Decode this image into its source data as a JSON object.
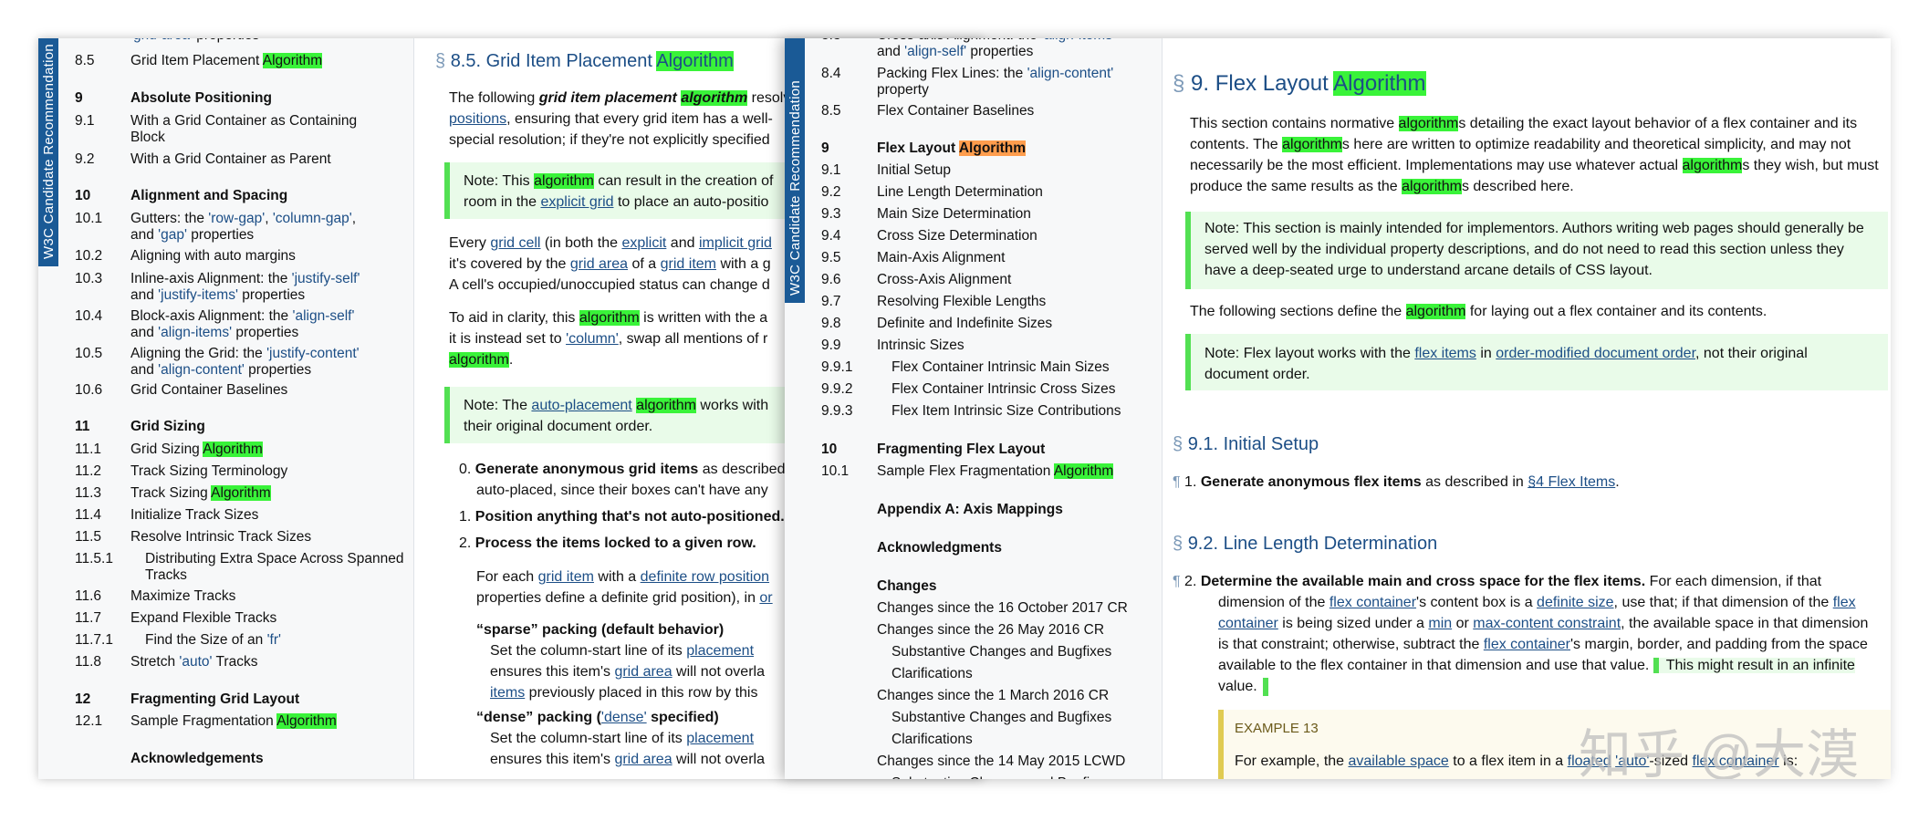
{
  "banner_text": "W3C Candidate Recommendation",
  "grid_toc": [
    {
      "num": "",
      "title": "'grid-area' properties",
      "clip": true
    },
    {
      "num": "8.5",
      "title": "Grid Item Placement ",
      "hl": "Algorithm"
    },
    {
      "num": "9",
      "title": "Absolute Positioning",
      "bold": true
    },
    {
      "num": "9.1",
      "title": "With a Grid Container as Containing",
      "title2": "Block"
    },
    {
      "num": "9.2",
      "title": "With a Grid Container as Parent"
    },
    {
      "num": "10",
      "title": "Alignment and Spacing",
      "bold": true
    },
    {
      "num": "10.1",
      "title": "Gutters: the 'row-gap', 'column-gap',",
      "title2": "and 'gap' properties"
    },
    {
      "num": "10.2",
      "title": "Aligning with auto margins"
    },
    {
      "num": "10.3",
      "title": "Inline-axis Alignment: the 'justify-self'",
      "title2": "and 'justify-items' properties"
    },
    {
      "num": "10.4",
      "title": "Block-axis Alignment: the 'align-self'",
      "title2": "and 'align-items' properties"
    },
    {
      "num": "10.5",
      "title": "Aligning the Grid: the 'justify-content'",
      "title2": "and 'align-content' properties"
    },
    {
      "num": "10.6",
      "title": "Grid Container Baselines"
    },
    {
      "num": "11",
      "title": "Grid Sizing",
      "bold": true
    },
    {
      "num": "11.1",
      "title": "Grid Sizing ",
      "hl": "Algorithm"
    },
    {
      "num": "11.2",
      "title": "Track Sizing Terminology"
    },
    {
      "num": "11.3",
      "title": "Track Sizing ",
      "hl": "Algorithm"
    },
    {
      "num": "11.4",
      "title": "Initialize Track Sizes"
    },
    {
      "num": "11.5",
      "title": "Resolve Intrinsic Track Sizes"
    },
    {
      "num": "11.5.1",
      "title": "Distributing Extra Space Across Spanned",
      "title2": "Tracks",
      "indent": true
    },
    {
      "num": "11.6",
      "title": "Maximize Tracks"
    },
    {
      "num": "11.7",
      "title": "Expand Flexible Tracks"
    },
    {
      "num": "11.7.1",
      "title": "Find the Size of an 'fr'",
      "indent": true
    },
    {
      "num": "11.8",
      "title": "Stretch 'auto' Tracks"
    },
    {
      "num": "12",
      "title": "Fragmenting Grid Layout",
      "bold": true
    },
    {
      "num": "12.1",
      "title": "Sample Fragmentation ",
      "hl": "Algorithm"
    },
    {
      "num": "",
      "title": "Acknowledgements",
      "bold": true
    }
  ],
  "grid_doc": {
    "heading_sign": "§",
    "heading": "8.5. Grid Item Placement ",
    "heading_hl": "Algorithm",
    "p1": [
      "The following ",
      "grid item placement ",
      "algorithm",
      " resolv"
    ],
    "p1b": [
      "positions",
      ", ensuring that every grid item has a well-"
    ],
    "p1c": "special resolution; if they're not explicitly specified",
    "note1a": [
      "Note: This ",
      "algorithm",
      " can result in the creation of"
    ],
    "note1b": [
      "room in the ",
      "explicit grid",
      " to place an auto-positio"
    ],
    "p2a": [
      "Every ",
      "grid cell",
      " (in both the ",
      "explicit",
      " and ",
      "implicit grid"
    ],
    "p2b": [
      "it's covered by the ",
      "grid area",
      " of a ",
      "grid item",
      " with a g"
    ],
    "p2c": "A cell's occupied/unoccupied status can change d",
    "p3a": [
      "To aid in clarity, this ",
      "algorithm",
      " is written with the a"
    ],
    "p3b": [
      "it is instead set to ",
      "'column'",
      ", swap all mentions of r"
    ],
    "p3c": [
      "algorithm",
      "."
    ],
    "note2a": [
      "Note: The ",
      "auto-placement",
      " ",
      "algorithm",
      " works with"
    ],
    "note2b": "their original document order.",
    "li0a": [
      "0. ",
      "Generate anonymous grid items",
      " as described"
    ],
    "li0b": "auto-placed, since their boxes can't have any",
    "li1": [
      "1. ",
      "Position anything that's not auto-positioned."
    ],
    "li2": [
      "2. ",
      "Process the items locked to a given row."
    ],
    "li2a": [
      "For each ",
      "grid item",
      " with a ",
      "definite row position"
    ],
    "li2b": [
      "properties define a definite grid position), in ",
      "or"
    ],
    "sparse": "“sparse” packing (default behavior)",
    "sparse_a": [
      "Set the column-start line of its ",
      "placement"
    ],
    "sparse_b": [
      "ensures this item's ",
      "grid area",
      " will not overla"
    ],
    "sparse_c": [
      "items",
      " previously placed in this row by this"
    ],
    "dense": [
      "“dense” packing (",
      "'dense'",
      " specified)"
    ],
    "dense_a": [
      "Set the column-start line of its ",
      "placement"
    ],
    "dense_b": [
      "ensures this item's ",
      "grid area",
      " will not overla"
    ]
  },
  "flex_toc": [
    {
      "num": "8.3",
      "title": "Cross-axis Alignment: the 'align-items'",
      "clip": true
    },
    {
      "num": "",
      "title": "and 'align-self' properties"
    },
    {
      "num": "8.4",
      "title": "Packing Flex Lines: the 'align-content'",
      "title2": "property"
    },
    {
      "num": "8.5",
      "title": "Flex Container Baselines"
    },
    {
      "num": "9",
      "title": "Flex Layout ",
      "hl_orange": "Algorithm",
      "bold": true
    },
    {
      "num": "9.1",
      "title": "Initial Setup"
    },
    {
      "num": "9.2",
      "title": "Line Length Determination"
    },
    {
      "num": "9.3",
      "title": "Main Size Determination"
    },
    {
      "num": "9.4",
      "title": "Cross Size Determination"
    },
    {
      "num": "9.5",
      "title": "Main-Axis Alignment"
    },
    {
      "num": "9.6",
      "title": "Cross-Axis Alignment"
    },
    {
      "num": "9.7",
      "title": "Resolving Flexible Lengths"
    },
    {
      "num": "9.8",
      "title": "Definite and Indefinite Sizes"
    },
    {
      "num": "9.9",
      "title": "Intrinsic Sizes"
    },
    {
      "num": "9.9.1",
      "title": "Flex Container Intrinsic Main Sizes",
      "indent": true
    },
    {
      "num": "9.9.2",
      "title": "Flex Container Intrinsic Cross Sizes",
      "indent": true
    },
    {
      "num": "9.9.3",
      "title": "Flex Item Intrinsic Size Contributions",
      "indent": true
    },
    {
      "num": "10",
      "title": "Fragmenting Flex Layout",
      "bold": true
    },
    {
      "num": "10.1",
      "title": "Sample Flex Fragmentation ",
      "hl": "Algorithm"
    },
    {
      "num": "",
      "title": "Appendix A: Axis Mappings",
      "bold": true
    },
    {
      "num": "",
      "title": "Acknowledgments",
      "bold": true
    },
    {
      "num": "",
      "title": "Changes",
      "bold": true
    },
    {
      "num": "",
      "title": "Changes since the 16 October 2017 CR"
    },
    {
      "num": "",
      "title": "Changes since the 26 May 2016 CR"
    },
    {
      "num": "",
      "title": "Substantive Changes and Bugfixes",
      "indent": true
    },
    {
      "num": "",
      "title": "Clarifications",
      "indent": true
    },
    {
      "num": "",
      "title": "Changes since the 1 March 2016 CR"
    },
    {
      "num": "",
      "title": "Substantive Changes and Bugfixes",
      "indent": true
    },
    {
      "num": "",
      "title": "Clarifications",
      "indent": true
    },
    {
      "num": "",
      "title": "Changes since the 14 May 2015 LCWD"
    },
    {
      "num": "",
      "title": "Substantive Changes and Bugfixes",
      "indent": true,
      "clip": true
    }
  ],
  "flex_doc": {
    "heading_sign": "§",
    "heading": "9. Flex Layout ",
    "heading_hl": "Algorithm",
    "p1a": [
      "This section contains normative ",
      "algorithm",
      "s detailing the exact layout behavior of a flex container and its"
    ],
    "p1b": [
      "contents. The ",
      "algorithm",
      "s here are written to optimize readability and theoretical simplicity, and may not"
    ],
    "p1c": [
      "necessarily be the most efficient. Implementations may use whatever actual ",
      "algorithm",
      "s they wish, but must"
    ],
    "p1d": [
      "produce the same results as the ",
      "algorithm",
      "s described here."
    ],
    "note1a": "Note: This section is mainly intended for implementors. Authors writing web pages should generally be",
    "note1b": "served well by the individual property descriptions, and do not need to read this section unless they",
    "note1c": "have a deep-seated urge to understand arcane details of CSS layout.",
    "p2": [
      "The following sections define the ",
      "algorithm",
      " for laying out a flex container and its contents."
    ],
    "note2a": [
      "Note: Flex layout works with the ",
      "flex items",
      " in ",
      "order-modified document order",
      ", not their original"
    ],
    "note2b": "document order.",
    "h91": "9.1. Initial Setup",
    "pilcrow": "¶",
    "li1": [
      "1. ",
      "Generate anonymous flex items",
      " as described in ",
      "§4 Flex Items",
      "."
    ],
    "h92": "9.2. Line Length Determination",
    "li2a": [
      "2. ",
      "Determine the available main and cross space for the flex items.",
      " For each dimension, if that"
    ],
    "li2b": [
      "dimension of the ",
      "flex container",
      "'s content box is a ",
      "definite size",
      ", use that; if that dimension of the ",
      "flex"
    ],
    "li2c": [
      "container",
      " is being sized under a ",
      "min",
      " or ",
      "max-content constraint",
      ", the available space in that dimension"
    ],
    "li2d": [
      "is that constraint; otherwise, subtract the ",
      "flex container",
      "'s margin, border, and padding from the space"
    ],
    "li2e": [
      "available to the flex container in that dimension and use that value. ",
      "This might result in an infinite"
    ],
    "li2f": "value.",
    "example_title": "EXAMPLE 13",
    "example_a": [
      "For example, the ",
      "available space",
      " to a flex item in a ",
      "floated",
      " ",
      "'auto'",
      "-sized ",
      "flex container",
      " is:"
    ]
  },
  "watermark": "知乎 @大漠"
}
